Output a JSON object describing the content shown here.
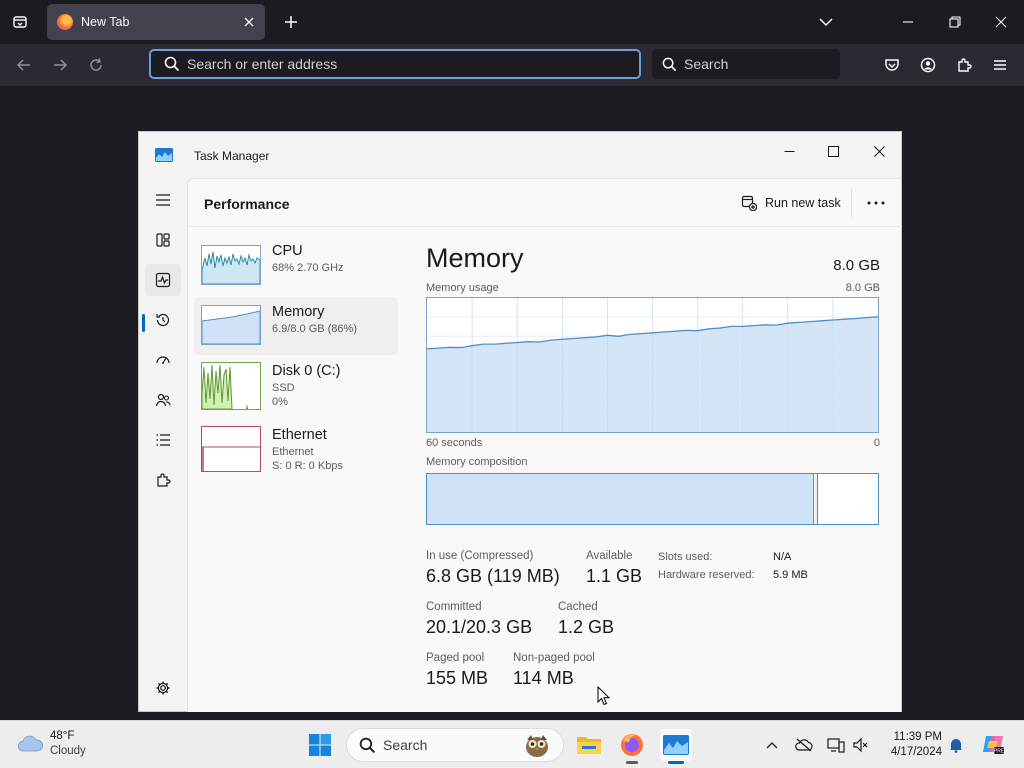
{
  "browser": {
    "tab": {
      "title": "New Tab"
    },
    "urlbar": {
      "placeholder": "Search or enter address"
    },
    "searchbar": {
      "placeholder": "Search"
    }
  },
  "task_manager": {
    "title": "Task Manager",
    "header": {
      "page_title": "Performance",
      "run_new_task": "Run new task"
    },
    "nav_icons": [
      "menu-icon",
      "processes-icon",
      "performance-icon",
      "app-history-icon",
      "startup-apps-icon",
      "users-icon",
      "details-icon",
      "services-icon",
      "settings-icon"
    ],
    "perf_items": [
      {
        "name": "CPU",
        "line1": "68% 2.70 GHz",
        "line2": ""
      },
      {
        "name": "Memory",
        "line1": "6.9/8.0 GB (86%)",
        "line2": ""
      },
      {
        "name": "Disk 0 (C:)",
        "line1": "SSD",
        "line2": "0%"
      },
      {
        "name": "Ethernet",
        "line1": "Ethernet",
        "line2": "S: 0 R: 0 Kbps"
      }
    ],
    "detail": {
      "title": "Memory",
      "total": "8.0 GB",
      "usage_label": "Memory usage",
      "usage_max": "8.0 GB",
      "time_left": "60 seconds",
      "time_right": "0",
      "composition_label": "Memory composition",
      "composition_in_use_fraction": 0.857,
      "usage_fraction_start": 0.62,
      "usage_fraction_end": 0.86,
      "stats": {
        "in_use_label": "In use (Compressed)",
        "in_use_value": "6.8 GB (119 MB)",
        "available_label": "Available",
        "available_value": "1.1 GB",
        "committed_label": "Committed",
        "committed_value": "20.1/20.3 GB",
        "cached_label": "Cached",
        "cached_value": "1.2 GB",
        "paged_pool_label": "Paged pool",
        "paged_pool_value": "155 MB",
        "non_paged_pool_label": "Non-paged pool",
        "non_paged_pool_value": "114 MB"
      },
      "side": {
        "slots_used_label": "Slots used:",
        "slots_used_value": "N/A",
        "hardware_reserved_label": "Hardware reserved:",
        "hardware_reserved_value": "5.9 MB"
      }
    }
  },
  "taskbar": {
    "weather": {
      "temp": "48°F",
      "condition": "Cloudy"
    },
    "search": {
      "label": "Search"
    },
    "clock": {
      "time": "11:39 PM",
      "date": "4/17/2024"
    },
    "colors": {
      "accent": "#0067c0",
      "graph_fill": "#cfe2f7",
      "graph_line": "#4f8fc8"
    }
  }
}
